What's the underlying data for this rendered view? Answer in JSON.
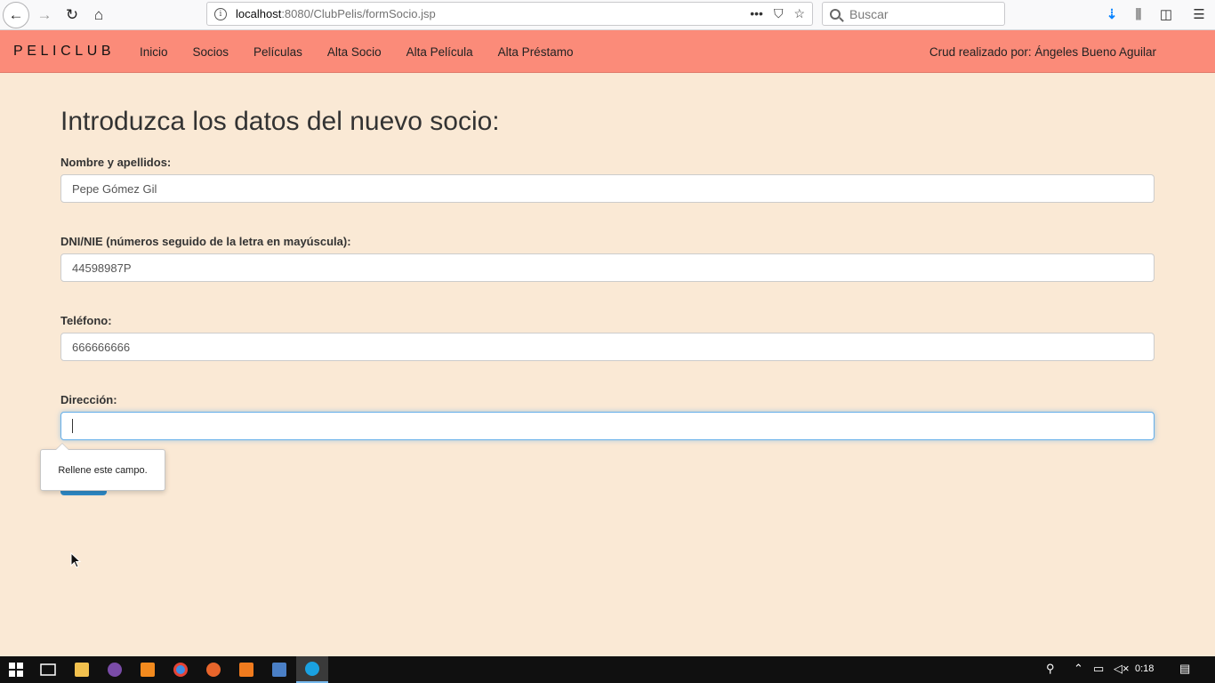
{
  "browser": {
    "url_host": "localhost",
    "url_path": ":8080/ClubPelis/formSocio.jsp",
    "search_placeholder": "Buscar",
    "url_actions": [
      "•••",
      "⛉",
      "☆"
    ]
  },
  "site": {
    "brand": "PELICLUB",
    "nav": [
      "Inicio",
      "Socios",
      "Películas",
      "Alta Socio",
      "Alta Película",
      "Alta Préstamo"
    ],
    "credit": "Crud realizado por: Ángeles Bueno Aguilar"
  },
  "form": {
    "heading": "Introduzca los datos del nuevo socio:",
    "fields": [
      {
        "label": "Nombre y apellidos:",
        "value": "Pepe Gómez Gil"
      },
      {
        "label": "DNI/NIE (números seguido de la letra en mayúscula):",
        "value": "44598987P"
      },
      {
        "label": "Teléfono:",
        "value": "666666666"
      },
      {
        "label": "Dirección:",
        "value": ""
      }
    ],
    "validation_message": "Rellene este campo."
  },
  "taskbar": {
    "clock": "0:18",
    "accent": "#76b9ed"
  },
  "colors": {
    "page_bg": "#fae9d5",
    "navbar_bg": "#fb8b79",
    "button": "#2e8bc9"
  }
}
